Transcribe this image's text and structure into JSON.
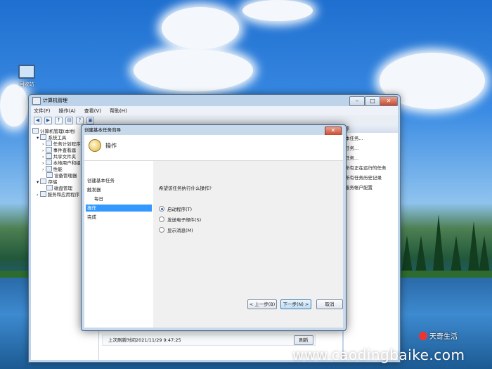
{
  "desktop": {
    "icon_label": "回收站"
  },
  "mmc": {
    "title": "计算机管理",
    "menu": [
      "文件(F)",
      "操作(A)",
      "查看(V)",
      "帮助(H)"
    ],
    "tree": [
      "计算机管理(本地)",
      "系统工具",
      "任务计划程序",
      "事件查看器",
      "共享文件夹",
      "本地用户和组",
      "性能",
      "设备管理器",
      "存储",
      "磁盘管理",
      "服务和应用程序"
    ],
    "actions": {
      "header": "序",
      "items": [
        "本任务...",
        "任务...",
        "任务...",
        "所有正在运行的任务",
        "所有任务历史记录",
        "服务帐户配置"
      ]
    },
    "status": "上次刷新时间2021/11/29 9:47:25",
    "refresh_label": "刷新"
  },
  "wizard": {
    "title": "创建基本任务向导",
    "header": "操作",
    "steps": [
      "创建基本任务",
      "触发器",
      "每日",
      "操作",
      "完成"
    ],
    "selected_step": "操作",
    "question": "希望该任务执行什么操作?",
    "options": [
      {
        "label": "启动程序(T)",
        "checked": true
      },
      {
        "label": "发送电子邮件(S)",
        "checked": false
      },
      {
        "label": "显示消息(M)",
        "checked": false
      }
    ],
    "buttons": {
      "back": "< 上一步(B)",
      "next": "下一步(N) >",
      "cancel": "取消"
    }
  },
  "watermark": "www.caodingbaike.com",
  "brand": "天奇生活"
}
